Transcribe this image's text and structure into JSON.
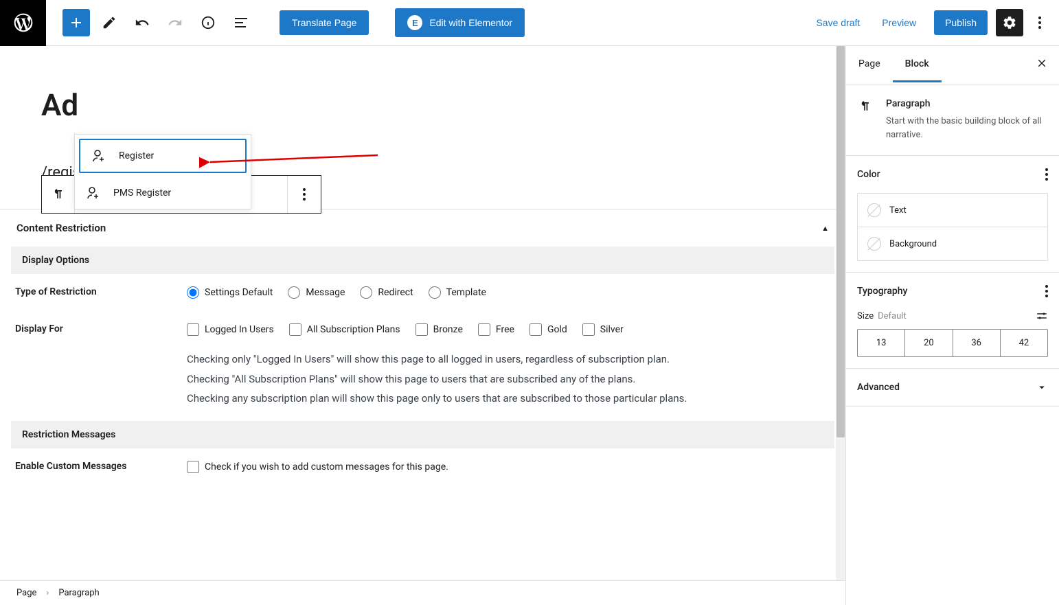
{
  "toolbar": {
    "translate_label": "Translate Page",
    "elementor_label": "Edit with Elementor",
    "save_draft": "Save draft",
    "preview": "Preview",
    "publish": "Publish"
  },
  "editor": {
    "page_title_partial": "Ad",
    "slash_command": "/register",
    "autocomplete": [
      {
        "label": "Register"
      },
      {
        "label": "PMS Register"
      }
    ]
  },
  "content_restriction": {
    "title": "Content Restriction",
    "display_options_header": "Display Options",
    "type_label": "Type of Restriction",
    "type_options": [
      "Settings Default",
      "Message",
      "Redirect",
      "Template"
    ],
    "display_for_label": "Display For",
    "display_for_options": [
      "Logged In Users",
      "All Subscription Plans",
      "Bronze",
      "Free",
      "Gold",
      "Silver"
    ],
    "help_line1": "Checking only \"Logged In Users\" will show this page to all logged in users, regardless of subscription plan.",
    "help_line2": "Checking \"All Subscription Plans\" will show this page to users that are subscribed any of the plans.",
    "help_line3": "Checking any subscription plan will show this page only to users that are subscribed to those particular plans.",
    "restriction_messages_header": "Restriction Messages",
    "enable_custom_label": "Enable Custom Messages",
    "enable_custom_check": "Check if you wish to add custom messages for this page."
  },
  "sidebar": {
    "tab_page": "Page",
    "tab_block": "Block",
    "block_name": "Paragraph",
    "block_desc": "Start with the basic building block of all narrative.",
    "color_header": "Color",
    "color_text": "Text",
    "color_background": "Background",
    "typography_header": "Typography",
    "size_label": "Size",
    "size_default": "Default",
    "size_options": [
      "13",
      "20",
      "36",
      "42"
    ],
    "advanced_header": "Advanced"
  },
  "breadcrumb": {
    "page": "Page",
    "paragraph": "Paragraph"
  }
}
